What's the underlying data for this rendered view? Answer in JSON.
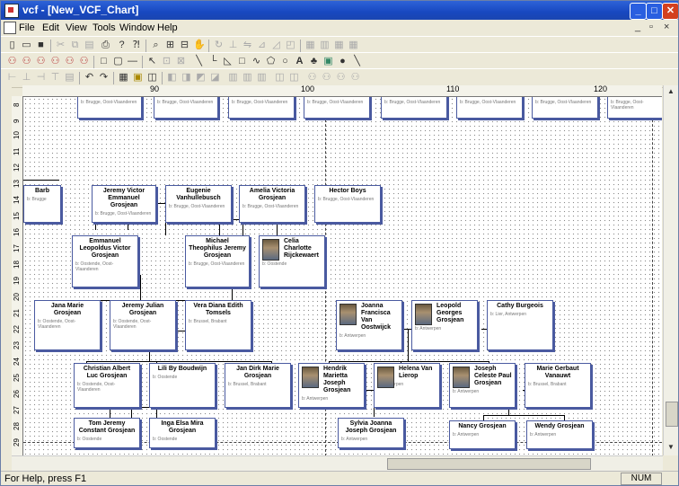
{
  "window": {
    "title": "vcf - [New_VCF_Chart]"
  },
  "menu": [
    "File",
    "Edit",
    "View",
    "Tools",
    "Window",
    "Help"
  ],
  "ruler": {
    "h": [
      "90",
      "100",
      "110",
      "120"
    ],
    "v": [
      "8",
      "9",
      "10",
      "11",
      "12",
      "13",
      "14",
      "15",
      "16",
      "17",
      "18",
      "19",
      "20",
      "21",
      "22",
      "23",
      "24",
      "25",
      "26",
      "27",
      "28",
      "29"
    ]
  },
  "status": {
    "help": "For Help, press F1",
    "num": "NUM"
  },
  "people": {
    "top1": {
      "name": "",
      "dates": "b: Brugge, Oost-Vlaanderen"
    },
    "top2": {
      "name": "",
      "dates": "b: Brugge, Oost-Vlaanderen"
    },
    "top3": {
      "name": "",
      "dates": "b: Brugge, Oost-Vlaanderen"
    },
    "top4": {
      "name": "",
      "dates": "b: Brugge, Oost-Vlaanderen"
    },
    "top5": {
      "name": "",
      "dates": "b: Brugge, Oost-Vlaanderen"
    },
    "top6": {
      "name": "",
      "dates": "b: Brugge, Oost-Vlaanderen"
    },
    "top7": {
      "name": "",
      "dates": "b: Brugge, Oost-Vlaanderen"
    },
    "top8": {
      "name": "",
      "dates": "b: Brugge, Oost-Vlaanderen"
    },
    "r1a": {
      "name": "Barb",
      "dates": "b: Brugge"
    },
    "r1b": {
      "name": "Jeremy Victor Emmanuel Grosjean",
      "dates": "b: Brugge, Oost-Vlaanderen"
    },
    "r1c": {
      "name": "Eugenie Vanhullebusch",
      "dates": "b: Brugge, Oost-Vlaanderen"
    },
    "r1d": {
      "name": "Amelia Victoria Grosjean",
      "dates": "b: Brugge, Oost-Vlaanderen"
    },
    "r1e": {
      "name": "Hector Boys",
      "dates": "b: Brugge, Oost-Vlaanderen"
    },
    "r2a": {
      "name": "Emmanuel Leopoldus Victor Grosjean",
      "dates": "b: Oostende, Oost-Vlaanderen"
    },
    "r2b": {
      "name": "Michael Theophilus Jeremy Grosjean",
      "dates": "b: Brugge, Oost-Vlaanderen"
    },
    "r2c": {
      "name": "Celia Charlotte Rijckewaert",
      "dates": "b: Oostende"
    },
    "r3a": {
      "name": "Jana Marie Grosjean",
      "dates": "b: Oostende, Oost-Vlaanderen"
    },
    "r3b": {
      "name": "Jeremy Julian Grosjean",
      "dates": "b: Oostende, Oost-Vlaanderen"
    },
    "r3c": {
      "name": "Vera Diana Edith Tomsels",
      "dates": "b: Brussel, Brabant"
    },
    "r3d": {
      "name": "Joanna Francisca Van Oostwijck",
      "dates": "b: Antwerpen"
    },
    "r3e": {
      "name": "Leopold Georges Grosjean",
      "dates": "b: Antwerpen"
    },
    "r3f": {
      "name": "Cathy Burgeois",
      "dates": "b: Lier, Antwerpen"
    },
    "r4a": {
      "name": "Christian Albert Luc Grosjean",
      "dates": "b: Oostende, Oost-Vlaanderen"
    },
    "r4b": {
      "name": "Lili By Boudwijn",
      "dates": "b: Oostende"
    },
    "r4c": {
      "name": "Jan Dirk Marie Grosjean",
      "dates": "b: Brussel, Brabant"
    },
    "r4d": {
      "name": "Hendrik Marietta Joseph Grosjean",
      "dates": "b: Antwerpen"
    },
    "r4e": {
      "name": "Helena Van Lierop",
      "dates": "b: Antwerpen"
    },
    "r4f": {
      "name": "Joseph Celeste Paul Grosjean",
      "dates": "b: Antwerpen"
    },
    "r4g": {
      "name": "Marie Gerbaut Vanauwt",
      "dates": "b: Brussel, Brabant"
    },
    "r5a": {
      "name": "Tom Jeremy Constant Grosjean",
      "dates": "b: Oostende"
    },
    "r5b": {
      "name": "Inga Elsa Mira Grosjean",
      "dates": "b: Oostende"
    },
    "r5c": {
      "name": "Sylvia Joanna Joseph Grosjean",
      "dates": "b: Antwerpen"
    },
    "r5d": {
      "name": "Nancy Grosjean",
      "dates": "b: Antwerpen"
    },
    "r5e": {
      "name": "Wendy Grosjean",
      "dates": "b: Antwerpen"
    }
  }
}
